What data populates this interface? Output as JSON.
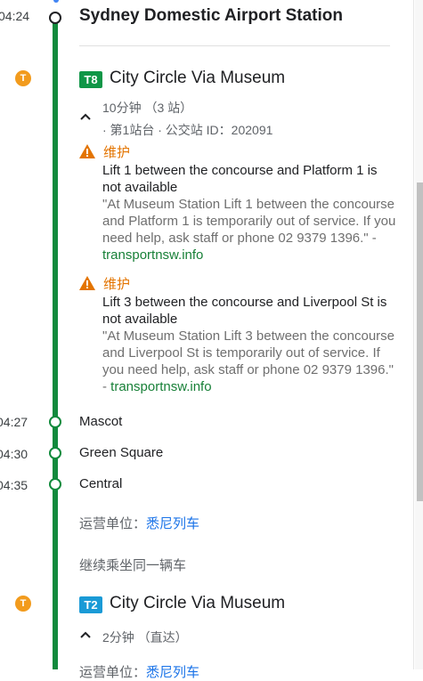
{
  "origin": {
    "time": "04:24",
    "station": "Sydney Domestic Airport Station"
  },
  "legs": [
    {
      "mode_icon": "T",
      "route_badge": "T8",
      "badge_color": "#0f9647",
      "route_name": "City Circle Via Museum",
      "duration": "10分钟 （3 站）",
      "platform": "· 第1站台 · 公交站 ID：202091",
      "alerts": [
        {
          "label": "维护",
          "title": "Lift 1 between the concourse and Platform 1 is not available",
          "desc": "\"At Museum Station Lift 1 between the concourse and Platform 1 is temporarily out of service. If you need help, ask staff or phone 02 9379 1396.\" - ",
          "source": "transportnsw.info"
        },
        {
          "label": "维护",
          "title": "Lift 3 between the concourse and Liverpool St is not available",
          "desc": "\"At Museum Station Lift 3 between the concourse and Liverpool St is temporarily out of service. If you need help, ask staff or phone 02 9379 1396.\" - ",
          "source": "transportnsw.info"
        }
      ],
      "stops": [
        {
          "time": "04:27",
          "name": "Mascot"
        },
        {
          "time": "04:30",
          "name": "Green Square"
        },
        {
          "time": "04:35",
          "name": "Central"
        }
      ],
      "operator_label": "运营单位：",
      "operator_name": "悉尼列车",
      "continue_text": "继续乘坐同一辆车"
    },
    {
      "mode_icon": "T",
      "route_badge": "T2",
      "badge_color": "#1a9ad6",
      "route_name": "City Circle Via Museum",
      "duration": "2分钟 （直达）",
      "operator_label": "运营单位：",
      "operator_name": "悉尼列车"
    }
  ],
  "colors": {
    "rail": "#118a3c",
    "warning": "#e37400",
    "link": "#1a73e8",
    "source_link": "#188038"
  }
}
